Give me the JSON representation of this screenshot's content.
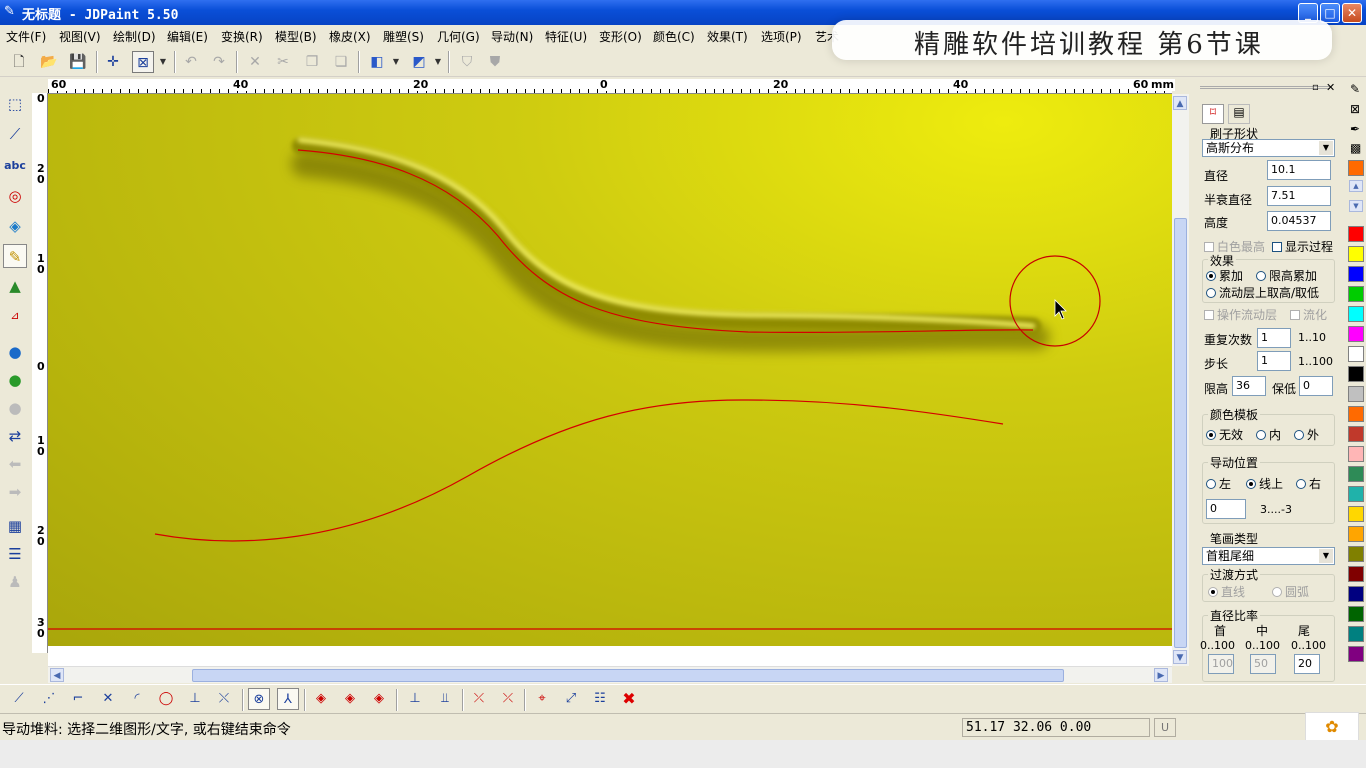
{
  "window": {
    "title": "无标题 - JDPaint 5.50",
    "controls": {
      "minimize": "_",
      "maximize": "□",
      "close": "✕"
    }
  },
  "overlay_caption": "精雕软件培训教程  第6节课",
  "menu": [
    "文件(F)",
    "视图(V)",
    "绘制(D)",
    "编辑(E)",
    "变换(R)",
    "模型(B)",
    "橡皮(X)",
    "雕塑(S)",
    "几何(G)",
    "导动(N)",
    "特征(U)",
    "变形(O)",
    "颜色(C)",
    "效果(T)",
    "选项(P)",
    "艺术"
  ],
  "toolbar_icons": [
    "new-file-icon",
    "open-folder-icon",
    "save-icon",
    "crosshair-icon",
    "select-box-icon",
    "undo-icon",
    "redo-icon",
    "cut-icon",
    "scissors-icon",
    "copy-icon",
    "paste-icon",
    "cube-view-icon",
    "cube-front-icon",
    "relief-mask-icon",
    "relief-shield-icon"
  ],
  "rulers": {
    "unit": "mm",
    "h_labels": [
      "60",
      "40",
      "20",
      "0",
      "20",
      "40",
      "60"
    ],
    "v_labels": [
      "0",
      "2 0",
      "1 0",
      "0",
      "1 0",
      "2 0",
      "3 0"
    ]
  },
  "right_panel": {
    "tabs": [
      "brush-tab-icon",
      "page-tab-icon"
    ],
    "brush_shape_label": "刷子形状",
    "brush_shape_value": "高斯分布",
    "diameter_label": "直径",
    "diameter_value": "10.1",
    "half_decay_label": "半衰直径",
    "half_decay_value": "7.51",
    "height_label": "高度",
    "height_value": "0.04537",
    "white_highest_label": "白色最高",
    "show_process_label": "显示过程",
    "effect_label": "效果",
    "effect_add": "累加",
    "effect_limit_add": "限高累加",
    "effect_flow": "流动层上取高/取低",
    "op_flow_layer": "操作流动层",
    "flow_label": "流化",
    "repeat_label": "重复次数",
    "repeat_value": "1",
    "repeat_range": "1..10",
    "step_label": "步长",
    "step_value": "1",
    "step_range": "1..100",
    "limit_high_label": "限高",
    "limit_high_value": "36",
    "keep_low_label": "保低",
    "keep_low_value": "0",
    "color_template_label": "颜色模板",
    "ct_none": "无效",
    "ct_inner": "内",
    "ct_outer": "外",
    "guide_pos_label": "导动位置",
    "gp_left": "左",
    "gp_online": "线上",
    "gp_right": "右",
    "guide_offset_value": "0",
    "guide_offset_range": "3....-3",
    "stroke_type_label": "笔画类型",
    "stroke_type_value": "首粗尾细",
    "transition_label": "过渡方式",
    "tr_line": "直线",
    "tr_arc": "圆弧",
    "diam_ratio_label": "直径比率",
    "ratio_head": "首",
    "ratio_mid": "中",
    "ratio_tail": "尾",
    "ratio_head_range": "0..100",
    "ratio_mid_range": "0..100",
    "ratio_tail_range": "0..100",
    "ratio_head_value": "100",
    "ratio_mid_value": "50",
    "ratio_tail_value": "20"
  },
  "palette": [
    "#ff6a00",
    "#ffffff",
    "#ff0000",
    "#ffff00",
    "#0000ff",
    "#00cc00",
    "#00ffff",
    "#ff00ff",
    "#ffffff",
    "#000000",
    "#c0c0c0",
    "#ff6a00",
    "#c0392b",
    "#ffb6b6",
    "#2e8b57",
    "#20b2aa",
    "#ffd700",
    "#ffa500",
    "#808000",
    "#800000",
    "#000080",
    "#006400",
    "#008080",
    "#800080",
    "#4b0082"
  ],
  "bottom_tools": [
    "line-icon",
    "polyline-icon",
    "corner-icon",
    "cross-icon",
    "arc-icon",
    "circle-icon",
    "perpendicular-icon",
    "tangent-icon",
    "node-icon",
    "anchor-icon",
    "diamond-icon",
    "diamond2-icon",
    "diamond3-icon",
    "layer-up-icon",
    "layer-down-icon",
    "delete-node-icon",
    "delete-node2-icon",
    "stack-icon",
    "edit-node-icon",
    "list-icon",
    "cancel-icon"
  ],
  "status": {
    "message": "导动堆料: 选择二维图形/文字, 或右键结束命令",
    "coords": "51.17 32.06 0.00",
    "unit_toggle": "U"
  }
}
